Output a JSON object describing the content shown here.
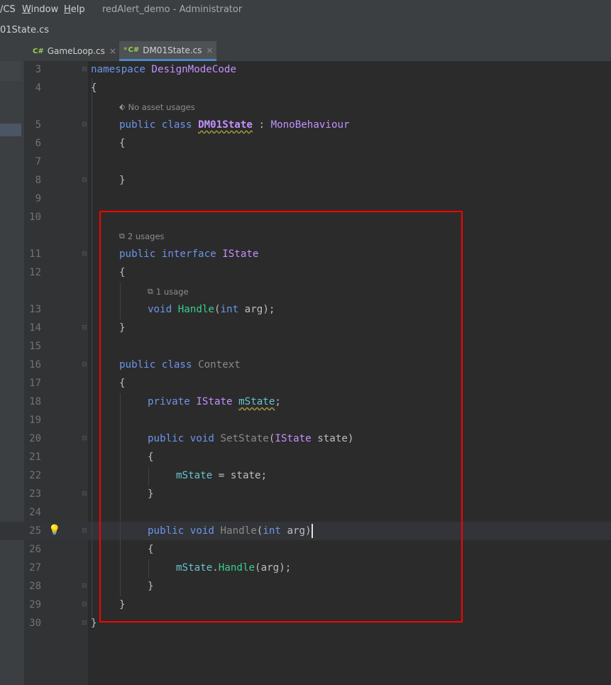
{
  "menubar": {
    "items": [
      {
        "label": "/CS",
        "mnemonic": ""
      },
      {
        "label": "indow",
        "mnemonic": "W"
      },
      {
        "label": "elp",
        "mnemonic": "H"
      }
    ]
  },
  "window_title": "redAlert_demo - Administrator",
  "breadcrumb": "01State.cs",
  "tabs": [
    {
      "icon_text": "C#",
      "label": "GameLoop.cs",
      "close": "×",
      "modified_mark": ""
    },
    {
      "icon_text": "C#",
      "label": "DM01State.cs",
      "close": "×",
      "modified_mark": "*"
    }
  ],
  "line_numbers": [
    "3",
    "4",
    "5",
    "6",
    "7",
    "8",
    "9",
    "10",
    "11",
    "12",
    "13",
    "14",
    "15",
    "16",
    "17",
    "18",
    "19",
    "20",
    "21",
    "22",
    "23",
    "24",
    "25",
    "26",
    "27",
    "28",
    "29",
    "30"
  ],
  "hints": {
    "no_asset": "No asset usages",
    "two_usages": "2 usages",
    "one_usage": "1 usage"
  },
  "code": {
    "l3": {
      "kw": "namespace",
      "name": "DesignModeCode"
    },
    "l4": "{",
    "l5": {
      "kw1": "public",
      "kw2": "class",
      "name": "DM01State",
      "colon": " : ",
      "base": "MonoBehaviour"
    },
    "l6": "{",
    "l8": "}",
    "l11": {
      "kw1": "public",
      "kw2": "interface",
      "name": "IState"
    },
    "l12": "{",
    "l13": {
      "kw": "void",
      "method": "Handle",
      "open": "(",
      "ptype": "int",
      "param": " arg",
      "close": ");"
    },
    "l14": "}",
    "l16": {
      "kw1": "public",
      "kw2": "class",
      "name": "Context"
    },
    "l17": "{",
    "l18": {
      "kw": "private",
      "type": "IState",
      "field": "mState",
      "end": ";"
    },
    "l20": {
      "kw1": "public",
      "kw2": "void",
      "method": "SetState",
      "open": "(",
      "ptype": "IState",
      "param": " state",
      "close": ")"
    },
    "l21": "{",
    "l22": {
      "field": "mState",
      "rest": " = state;"
    },
    "l23": "}",
    "l25": {
      "kw1": "public",
      "kw2": "void",
      "method": "Handle",
      "open": "(",
      "ptype": "int",
      "param": " arg",
      "close": ")"
    },
    "l26": "{",
    "l27": {
      "field": "mState",
      "dot": ".",
      "method": "Handle",
      "rest": "(arg);"
    },
    "l28": "}",
    "l29": "}",
    "l30": "}"
  },
  "colors": {
    "keyword": "#6c95eb",
    "type": "#c191ff",
    "method": "#39cc8f",
    "field": "#66c3cc",
    "highlight_box": "#ff0000"
  },
  "icons": [
    "minimize-icon",
    "csharp-icon",
    "close-icon",
    "fold-icon",
    "bulb-icon",
    "unity-icon",
    "usages-icon"
  ]
}
